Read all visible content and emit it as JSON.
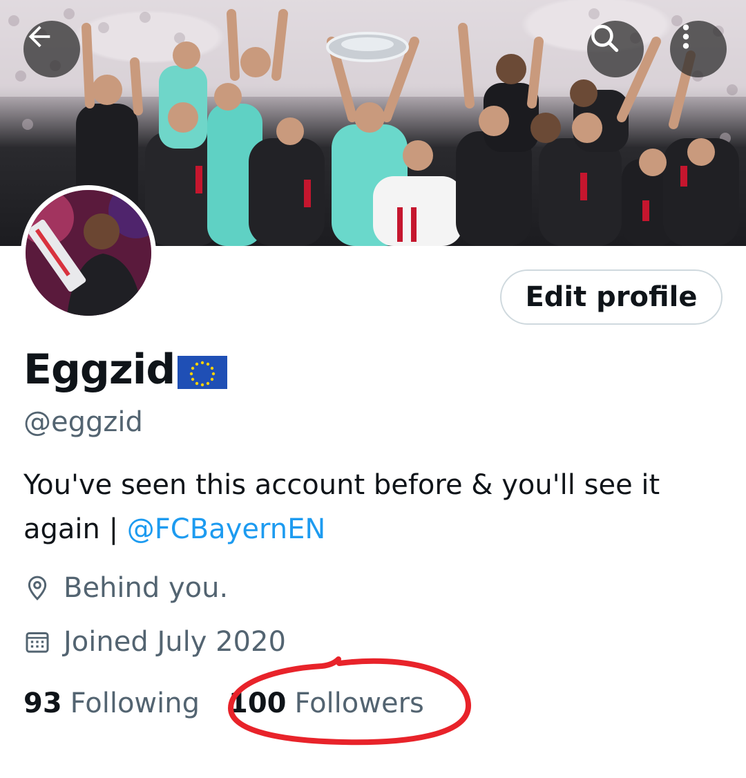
{
  "header": {
    "back_icon": "arrow-left-icon",
    "search_icon": "search-icon",
    "more_icon": "more-vertical-icon"
  },
  "profile": {
    "display_name": "Eggzid",
    "name_emoji": "eu-flag",
    "handle": "@eggzid",
    "edit_button_label": "Edit profile",
    "bio_text": "You've seen this account before & you'll see it again | ",
    "bio_link": "@FCBayernEN",
    "location": "Behind you.",
    "joined": "Joined July 2020"
  },
  "stats": {
    "following_count": "93",
    "following_label": "Following",
    "followers_count": "100",
    "followers_label": "Followers"
  },
  "colors": {
    "link": "#1d9bf0",
    "secondary_text": "#536471",
    "annotation": "#e8232a"
  }
}
